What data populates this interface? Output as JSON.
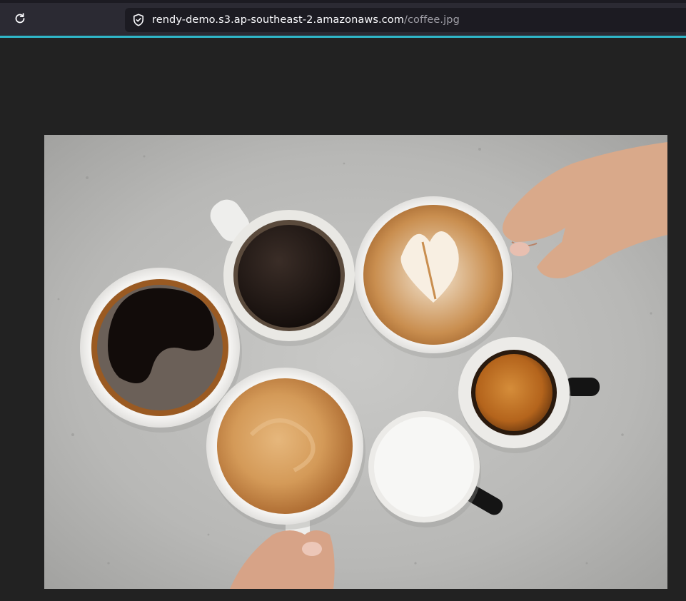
{
  "browser": {
    "url_host": "rendy-demo.s3.ap-southeast-2.amazonaws.com",
    "url_path": "/coffee.jpg",
    "reload_icon": "reload-icon",
    "security_icon": "shield-icon"
  },
  "image": {
    "subject": "coffee-cups-photo"
  },
  "colors": {
    "toolbar": "#2b2a33",
    "urlbar": "#1c1b22",
    "accent": "#2fb6c8",
    "page_background": "#222222"
  }
}
